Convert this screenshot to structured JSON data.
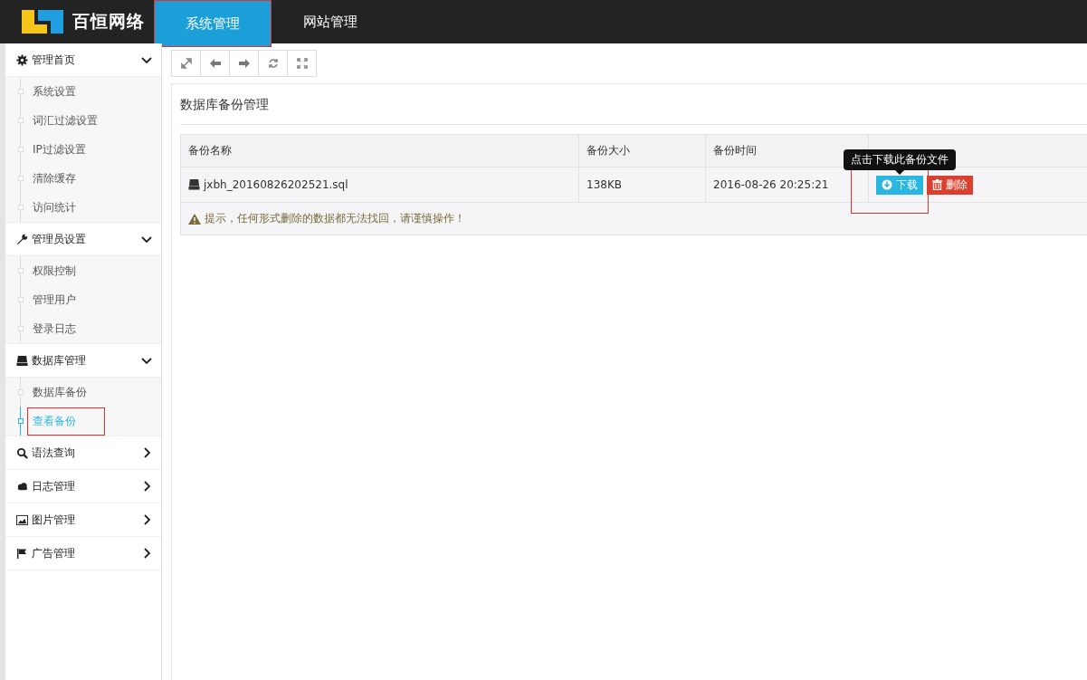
{
  "header": {
    "logo_text": "百恒网络",
    "tabs": [
      {
        "label": "系统管理",
        "selected": true,
        "highlighted": true
      },
      {
        "label": "网站管理",
        "selected": false,
        "highlighted": false
      }
    ]
  },
  "sidebar": {
    "groups": [
      {
        "label": "管理首页",
        "expanded": true,
        "children": [
          {
            "label": "系统设置",
            "selected": false,
            "highlighted": false
          },
          {
            "label": "词汇过滤设置",
            "selected": false,
            "highlighted": false
          },
          {
            "label": "IP过滤设置",
            "selected": false,
            "highlighted": false
          },
          {
            "label": "清除缓存",
            "selected": false,
            "highlighted": false
          },
          {
            "label": "访问统计",
            "selected": false,
            "highlighted": false
          }
        ]
      },
      {
        "label": "管理员设置",
        "expanded": true,
        "children": [
          {
            "label": "权限控制",
            "selected": false,
            "highlighted": false
          },
          {
            "label": "管理用户",
            "selected": false,
            "highlighted": false
          },
          {
            "label": "登录日志",
            "selected": false,
            "highlighted": false
          }
        ]
      },
      {
        "label": "数据库管理",
        "expanded": true,
        "children": [
          {
            "label": "数据库备份",
            "selected": false,
            "highlighted": false
          },
          {
            "label": "查看备份",
            "selected": true,
            "highlighted": true
          }
        ]
      },
      {
        "label": "语法查询",
        "expanded": false
      },
      {
        "label": "日志管理",
        "expanded": false
      },
      {
        "label": "图片管理",
        "expanded": false
      },
      {
        "label": "广告管理",
        "expanded": false
      }
    ]
  },
  "toolbar": {
    "buttons": [
      {
        "kind": "expand"
      },
      {
        "kind": "back"
      },
      {
        "kind": "forward"
      },
      {
        "kind": "refresh"
      },
      {
        "kind": "fullscreen"
      }
    ]
  },
  "panel": {
    "title": "数据库备份管理",
    "table": {
      "columns": [
        "备份名称",
        "备份大小",
        "备份时间"
      ],
      "rows": [
        {
          "name": "jxbh_20160826202521.sql",
          "size": "138KB",
          "time": "2016-08-26 20:25:21",
          "actions": [
            {
              "kind": "download",
              "label": "下载",
              "highlighted": true,
              "tooltip": "点击下载此备份文件"
            },
            {
              "kind": "delete",
              "label": "删除",
              "highlighted": false
            }
          ]
        }
      ],
      "notice": "提示，任何形式删除的数据都无法找回，请谨慎操作！"
    }
  }
}
